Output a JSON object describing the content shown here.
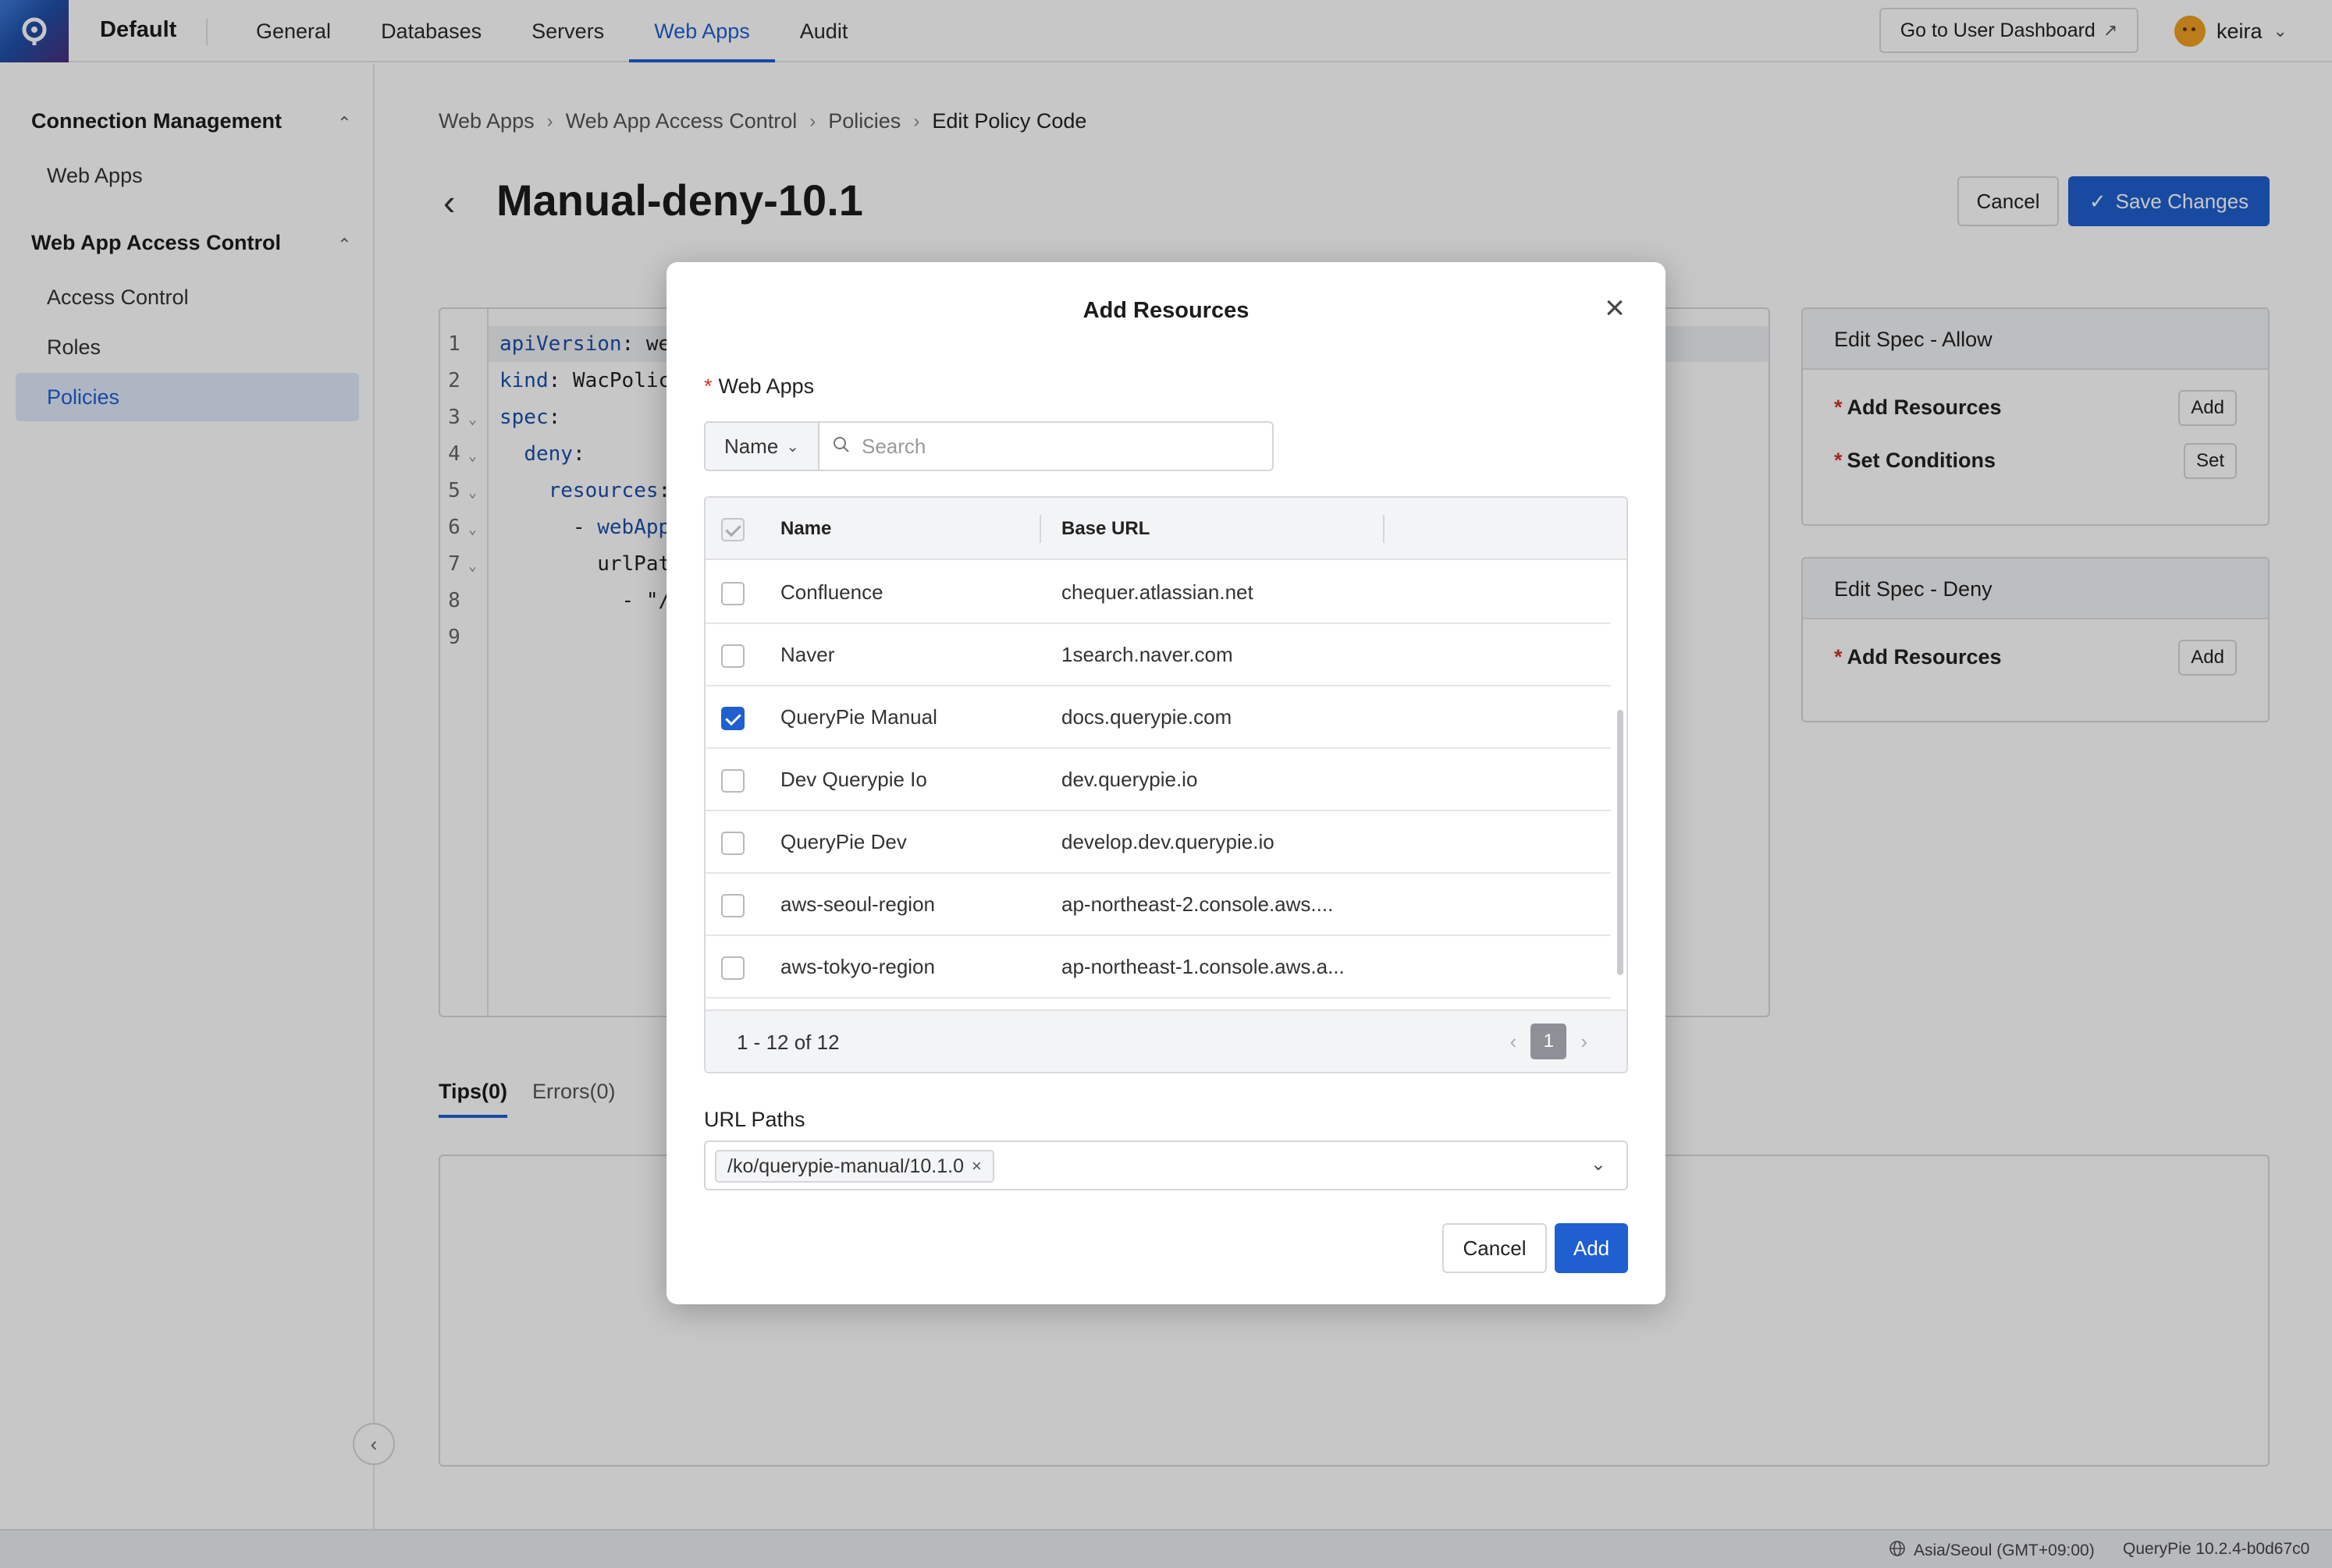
{
  "workspace": "Default",
  "nav": [
    "General",
    "Databases",
    "Servers",
    "Web Apps",
    "Audit"
  ],
  "nav_active": "Web Apps",
  "header": {
    "dashboard_button": "Go to User Dashboard",
    "username": "keira"
  },
  "sidebar": {
    "groups": [
      {
        "label": "Connection Management",
        "items": [
          "Web Apps"
        ]
      },
      {
        "label": "Web App Access Control",
        "items": [
          "Access Control",
          "Roles",
          "Policies"
        ]
      }
    ],
    "active_item": "Policies"
  },
  "breadcrumb": [
    "Web Apps",
    "Web App Access Control",
    "Policies",
    "Edit Policy Code"
  ],
  "page": {
    "title": "Manual-deny-10.1",
    "cancel_label": "Cancel",
    "save_label": "Save Changes"
  },
  "editor": {
    "lines": [
      {
        "n": "1",
        "fold": false,
        "text": "apiVersion: we"
      },
      {
        "n": "2",
        "fold": false,
        "text": "kind: WacPolic"
      },
      {
        "n": "3",
        "fold": true,
        "text": "spec:"
      },
      {
        "n": "4",
        "fold": true,
        "text": "  deny:"
      },
      {
        "n": "5",
        "fold": true,
        "text": "    resources:"
      },
      {
        "n": "6",
        "fold": true,
        "text": "      - webApp"
      },
      {
        "n": "7",
        "fold": true,
        "text": "        urlPat"
      },
      {
        "n": "8",
        "fold": false,
        "text": "          - \"/"
      },
      {
        "n": "9",
        "fold": false,
        "text": ""
      }
    ]
  },
  "spec_allow": {
    "title": "Edit Spec - Allow",
    "rows": [
      {
        "label": "Add Resources",
        "button": "Add"
      },
      {
        "label": "Set Conditions",
        "button": "Set"
      }
    ]
  },
  "spec_deny": {
    "title": "Edit Spec - Deny",
    "rows": [
      {
        "label": "Add Resources",
        "button": "Add"
      }
    ]
  },
  "tabs": [
    "Tips(0)",
    "Errors(0)"
  ],
  "modal": {
    "title": "Add Resources",
    "field_label": "Web Apps",
    "filter_select": "Name",
    "search_placeholder": "Search",
    "columns": [
      "Name",
      "Base URL"
    ],
    "rows": [
      {
        "name": "Confluence",
        "url": "chequer.atlassian.net",
        "checked": false
      },
      {
        "name": "Naver",
        "url": "1search.naver.com",
        "checked": false
      },
      {
        "name": "QueryPie Manual",
        "url": "docs.querypie.com",
        "checked": true
      },
      {
        "name": "Dev Querypie Io",
        "url": "dev.querypie.io",
        "checked": false
      },
      {
        "name": "QueryPie Dev",
        "url": "develop.dev.querypie.io",
        "checked": false
      },
      {
        "name": "aws-seoul-region",
        "url": "ap-northeast-2.console.aws....",
        "checked": false
      },
      {
        "name": "aws-tokyo-region",
        "url": "ap-northeast-1.console.aws.a...",
        "checked": false
      }
    ],
    "pagination_summary": "1 - 12 of 12",
    "current_page": "1",
    "url_paths_label": "URL Paths",
    "url_paths": [
      "/ko/querypie-manual/10.1.0"
    ],
    "cancel_label": "Cancel",
    "add_label": "Add"
  },
  "status": {
    "timezone": "Asia/Seoul (GMT+09:00)",
    "version": "QueryPie 10.2.4-b0d67c0"
  },
  "colors": {
    "accent": "#1f5fd0",
    "required": "#d8302f"
  }
}
